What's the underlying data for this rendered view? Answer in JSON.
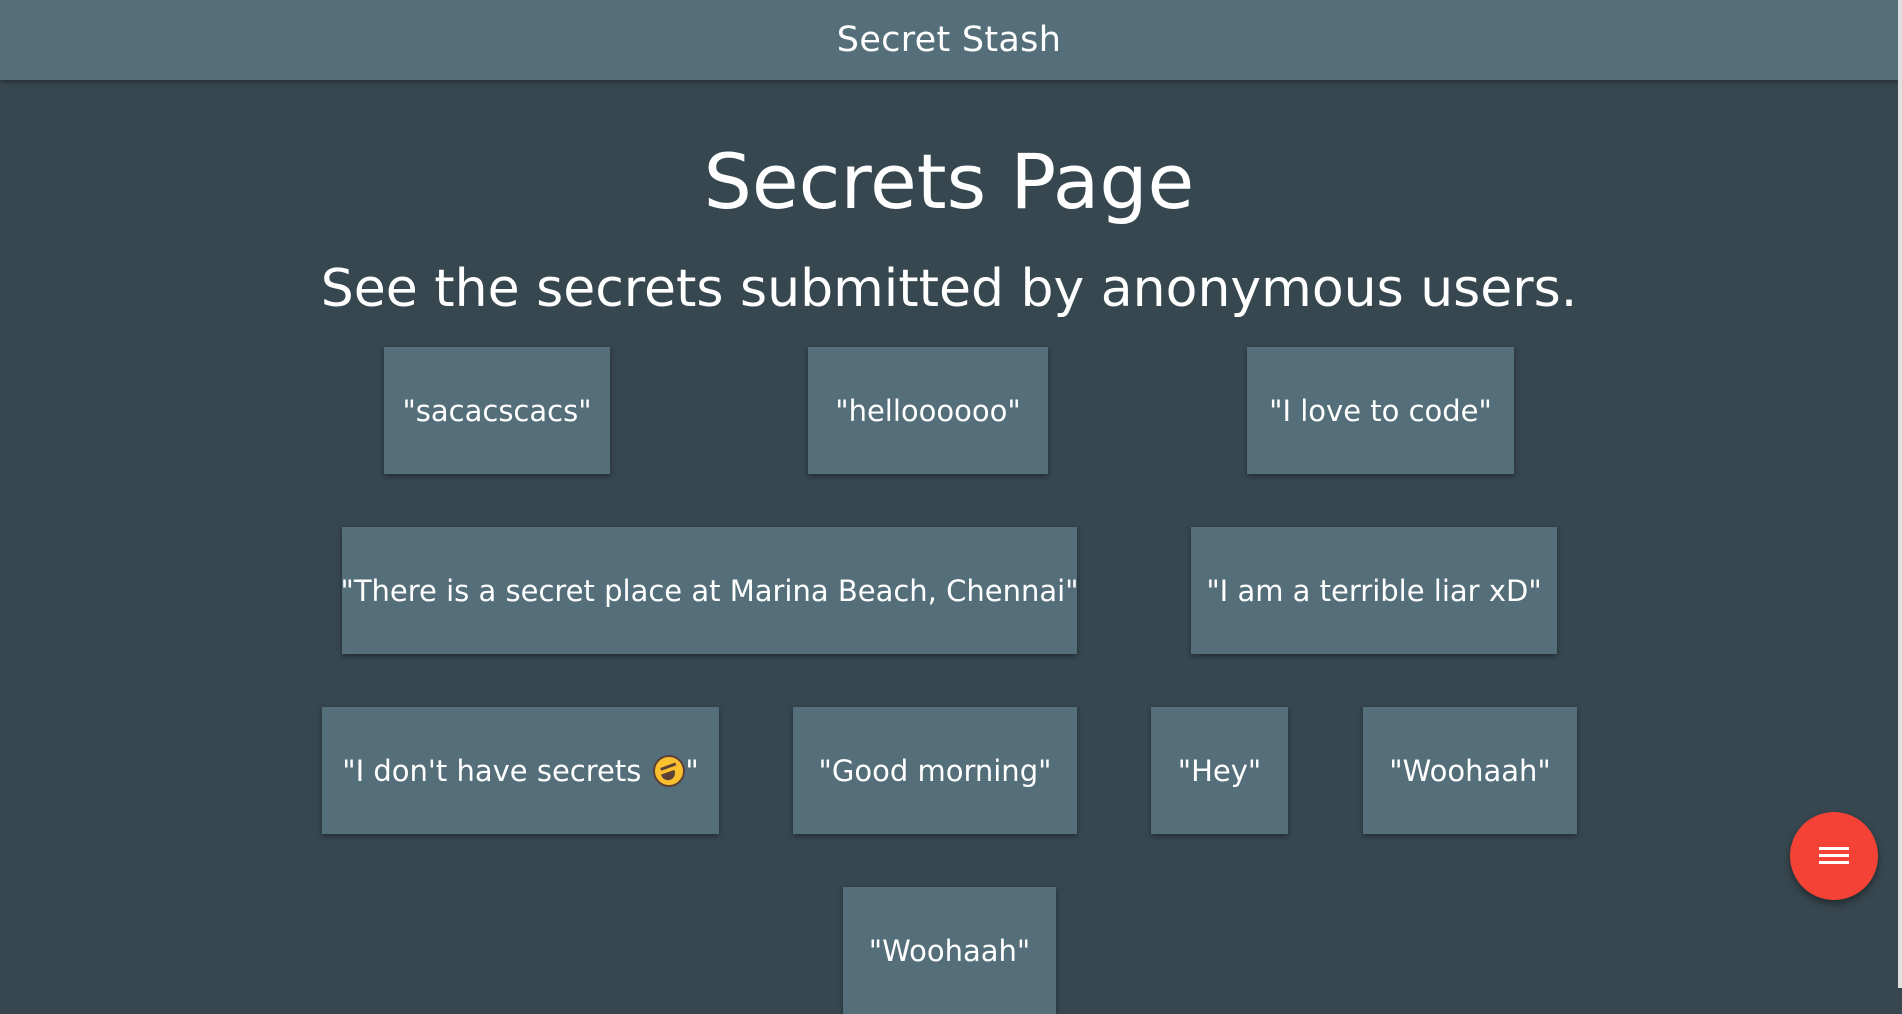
{
  "header": {
    "title": "Secret Stash"
  },
  "main": {
    "title": "Secrets Page",
    "subtitle": "See the secrets submitted by anonymous users.",
    "secrets": [
      {
        "text": "\"sacacscacs\""
      },
      {
        "text": "\"helloooooo\""
      },
      {
        "text": "\"I love to code\""
      },
      {
        "text": "\"There is a secret place at Marina Beach, Chennai\""
      },
      {
        "text": "\"I am a terrible liar xD\""
      },
      {
        "text_before": "\"I don't have secrets ",
        "emoji": "rolling-on-floor-laughing-emoji",
        "text_after": "\""
      },
      {
        "text": "\"Good morning\""
      },
      {
        "text": "\"Hey\""
      },
      {
        "text": "\"Woohaah\""
      },
      {
        "text": "\"Woohaah\""
      }
    ]
  },
  "fab": {
    "icon": "menu-icon",
    "color": "#f44336"
  },
  "colors": {
    "background": "#37474f",
    "navbar": "#546e7a",
    "card": "#546e7a"
  }
}
